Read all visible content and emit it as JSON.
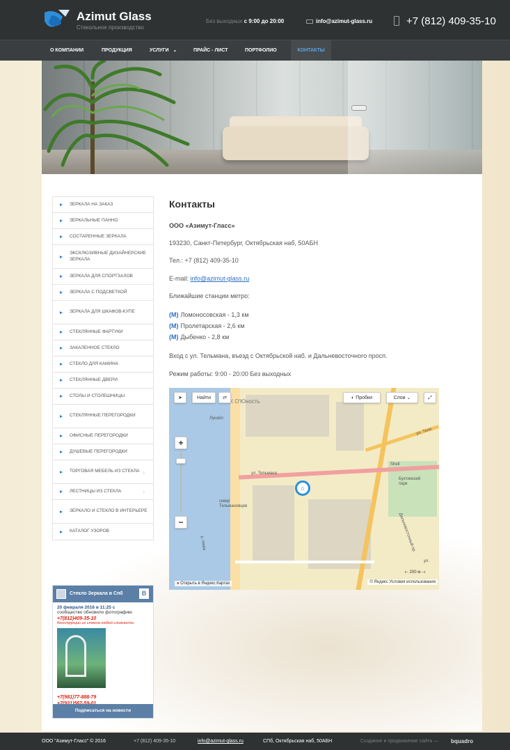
{
  "header": {
    "logo_title": "Azimut Glass",
    "logo_subtitle": "Стекольное производство",
    "hours_label": "Без выходных",
    "hours_value": "с 9:00 до 20:00",
    "email": "info@azimut-glass.ru",
    "phone": "+7 (812) 409-35-10"
  },
  "nav": {
    "items": [
      "О компании",
      "Продукция",
      "Услуги",
      "Прайс - лист",
      "Портфолио",
      "Контакты"
    ],
    "services_arrow": "⌄",
    "active": "Контакты"
  },
  "sidebar": {
    "items": [
      "Зеркала на заказ",
      "Зеркальные панно",
      "Состаренные зеркала",
      "Эксклюзивные дизайнерские зеркала",
      "Зеркала для спортзалов",
      "Зеркала с подсветкой",
      "Зеркала для шкафов-купе",
      "Стеклянные фартуки",
      "Закаленное стекло",
      "Стекло для камина",
      "Стеклянные двери",
      "Столы и столешницы",
      "Стеклянные перегородки",
      "Офисные перегородки",
      "Душевые перегородки",
      "Торговая мебель из стекла",
      "Лестницы из стекла",
      "Зеркало и стекло в интерьере",
      "Каталог узоров"
    ]
  },
  "vk_widget": {
    "title": "Стекло Зеркала в Спб",
    "badge": "B",
    "date": "20 февраля 2016 в 11:25 с",
    "note": "сообщество обновило фотографию",
    "phone1": "+7(812)409-35-10",
    "promo": "Конструкции из стекла любой сложности",
    "phone2": "+7(981)77-888-79",
    "phone3": "+7(931)567-59-01",
    "subscribe": "Подписаться на новости"
  },
  "content": {
    "title": "Контакты",
    "company": "ООО «Азимут-Гласс»",
    "address": "193230, Санкт-Петербург, Октябрьская наб, 50АБН",
    "phone_label": "Тел.:",
    "phone": "+7 (812) 409-35-10",
    "email_label": "E-mail:",
    "email": "info@azimut-glass.ru",
    "metro_title": "Ближайшие станции метро:",
    "metro_icon": "(M)",
    "metro": [
      "Ломоносовская - 1,3 км",
      "Пролетарская - 2,6 км",
      "Дыбенко - 2,8 км"
    ],
    "entrance": "Вход с ул. Тельмана, въезд с Октябрьской наб. и Дальневосточного просп.",
    "hours": "Режим работы: 9:00 - 20:00 Без выходных"
  },
  "map": {
    "find": "Найти",
    "traffic": "Пробки",
    "layers": "Слои",
    "zoom_in": "+",
    "zoom_out": "−",
    "district": "ЖК О'Юность",
    "poi_lukoil": "Лукойл",
    "poi_shell": "Shell",
    "street": "ул. Тельмана",
    "square": "сквер Тельмановцев",
    "park": "Бухтинский парк",
    "avenue": "Дальневосточный пр.",
    "street2": "ул. Тели",
    "river": "р. Нева",
    "street3": "ул.",
    "scale": "200 м",
    "open_link": "Открыть в Яндекс.Картах",
    "copyright": "© Яндекс Условия использования"
  },
  "footer": {
    "company": "ООО \"Азимут-Гласс\" © 2016",
    "phone": "+7 (812) 409-35-10",
    "email": "info@azimut-glass.ru",
    "address": "СПб, Октябрьская наб, 50АБН",
    "credit": "Создание и продвижение сайта —",
    "credit_brand": "bquadro"
  }
}
